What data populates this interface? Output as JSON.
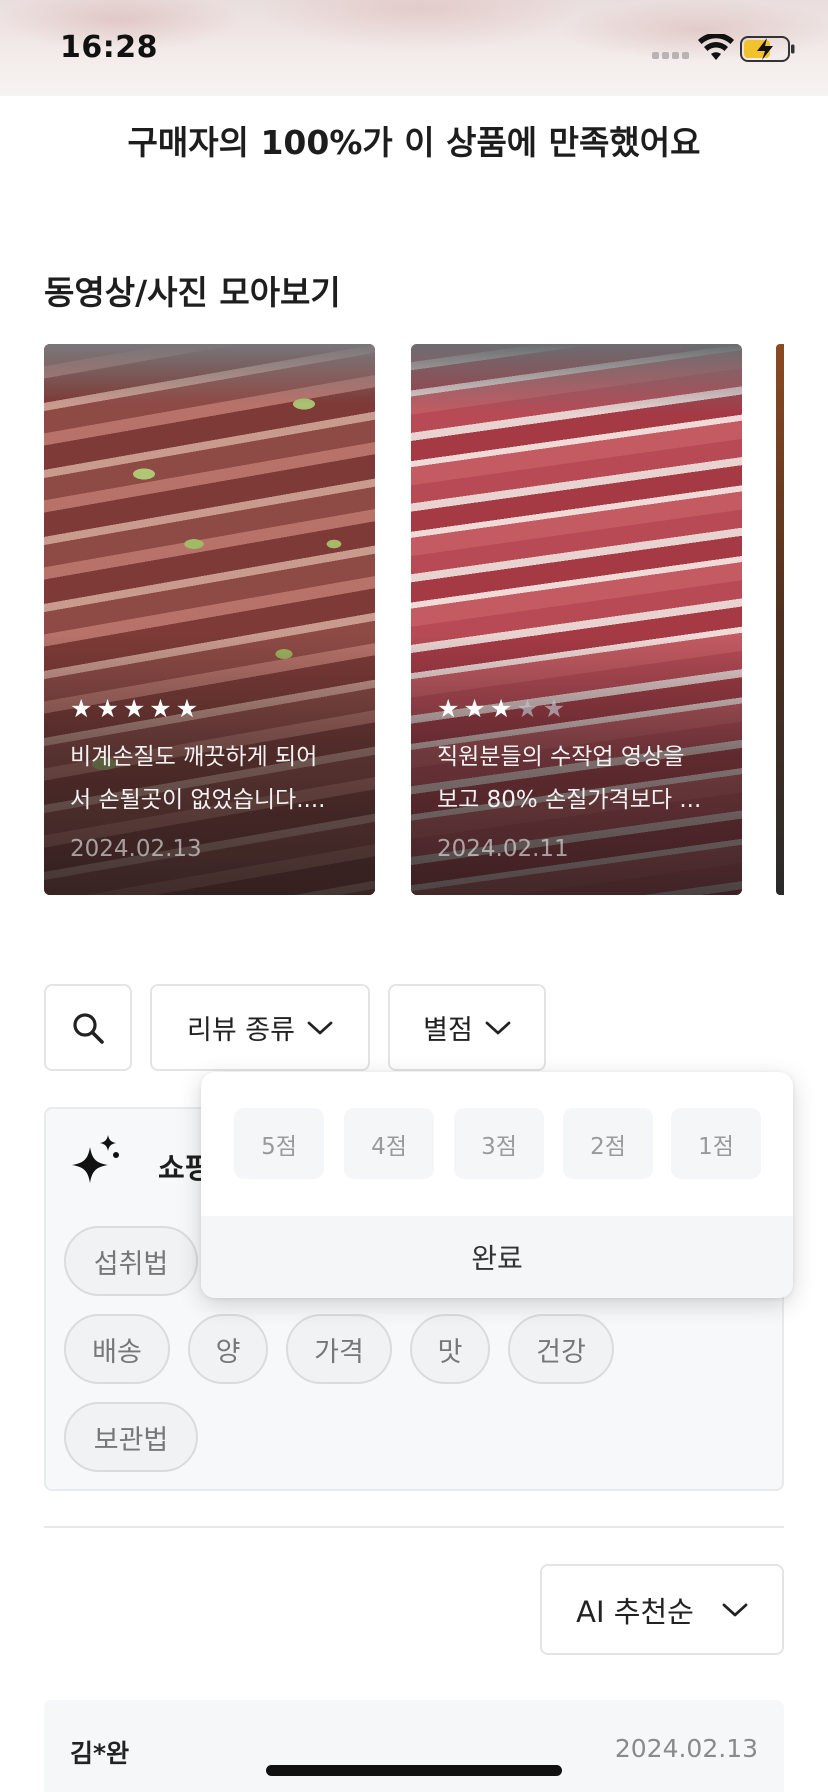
{
  "status_bar": {
    "time": "16:28"
  },
  "satisfaction_text": "구매자의 100%가 이 상품에 만족했어요",
  "gallery": {
    "title": "동영상/사진 모아보기",
    "cards": [
      {
        "rating": 5,
        "line1": "비계손질도 깨끗하게 되어",
        "line2": "서 손될곳이 없었습니다....",
        "date": "2024.02.13"
      },
      {
        "rating": 3,
        "line1": "직원분들의 수작업 영상을",
        "line2": "보고 80% 손질가격보다 ...",
        "date": "2024.02.11"
      }
    ]
  },
  "filters": {
    "review_type_label": "리뷰 종류",
    "rating_label": "별점"
  },
  "shopping_box": {
    "title": "쇼핑",
    "chips": [
      "섭취법",
      "배송",
      "양",
      "가격",
      "맛",
      "건강",
      "보관법"
    ]
  },
  "rating_popup": {
    "options": [
      "5점",
      "4점",
      "3점",
      "2점",
      "1점"
    ],
    "done_label": "완료"
  },
  "sort": {
    "label": "AI 추천순"
  },
  "review": {
    "reviewer": "김*완",
    "date": "2024.02.13"
  },
  "colors": {
    "accent_text": "#222222",
    "chip_bg": "#f1f2f3",
    "popup_option_bg": "#f5f6f7"
  }
}
